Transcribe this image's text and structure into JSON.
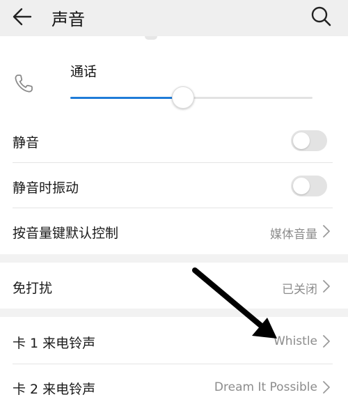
{
  "header": {
    "title": "声音",
    "back_icon": "arrow-left-icon",
    "search_icon": "search-icon"
  },
  "volume": {
    "label": "通话",
    "icon": "phone-icon",
    "level": 0.46,
    "accent_color": "#1f7cd8"
  },
  "settings": {
    "mute": {
      "label": "静音",
      "enabled": false
    },
    "vibrate_on_mute": {
      "label": "静音时振动",
      "enabled": false
    },
    "volume_key_default": {
      "label": "按音量键默认控制",
      "value": "媒体音量"
    },
    "do_not_disturb": {
      "label": "免打扰",
      "value": "已关闭"
    },
    "sim1_ringtone": {
      "label": "卡 1 来电铃声",
      "value": "Whistle"
    },
    "sim2_ringtone": {
      "label": "卡 2 来电铃声",
      "value": "Dream It Possible"
    }
  },
  "annotation": {
    "icon": "black-arrow-pointer"
  }
}
